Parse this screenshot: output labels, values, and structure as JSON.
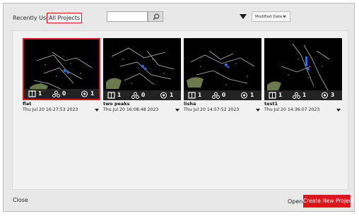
{
  "tabs": {
    "recent": "Recently Used",
    "all": "All Projects"
  },
  "search": {
    "value": "",
    "icon": "search-icon"
  },
  "sort": {
    "selected": "Modified Date"
  },
  "projects": [
    {
      "name": "flat",
      "date": "Thu Jul 20 16:27:53 2023",
      "stat1": "1",
      "stat2": "0",
      "stat3": "1",
      "selected": true
    },
    {
      "name": "two peaks",
      "date": "Thu Jul 20 16:08:48 2023",
      "stat1": "1",
      "stat2": "0",
      "stat3": "1",
      "selected": false
    },
    {
      "name": "lisha",
      "date": "Thu Jul 20 14:57:52 2023",
      "stat1": "1",
      "stat2": "0",
      "stat3": "1",
      "selected": false
    },
    {
      "name": "test1",
      "date": "Thu Jul 20 14:36:07 2023",
      "stat1": "1",
      "stat2": "1",
      "stat3": "3",
      "selected": false
    }
  ],
  "footer": {
    "close": "Close",
    "open": "Open",
    "create": "Create New Project"
  },
  "colors": {
    "accent": "#e0141b",
    "background": "#e8e8e8",
    "thumb": "#000000"
  }
}
